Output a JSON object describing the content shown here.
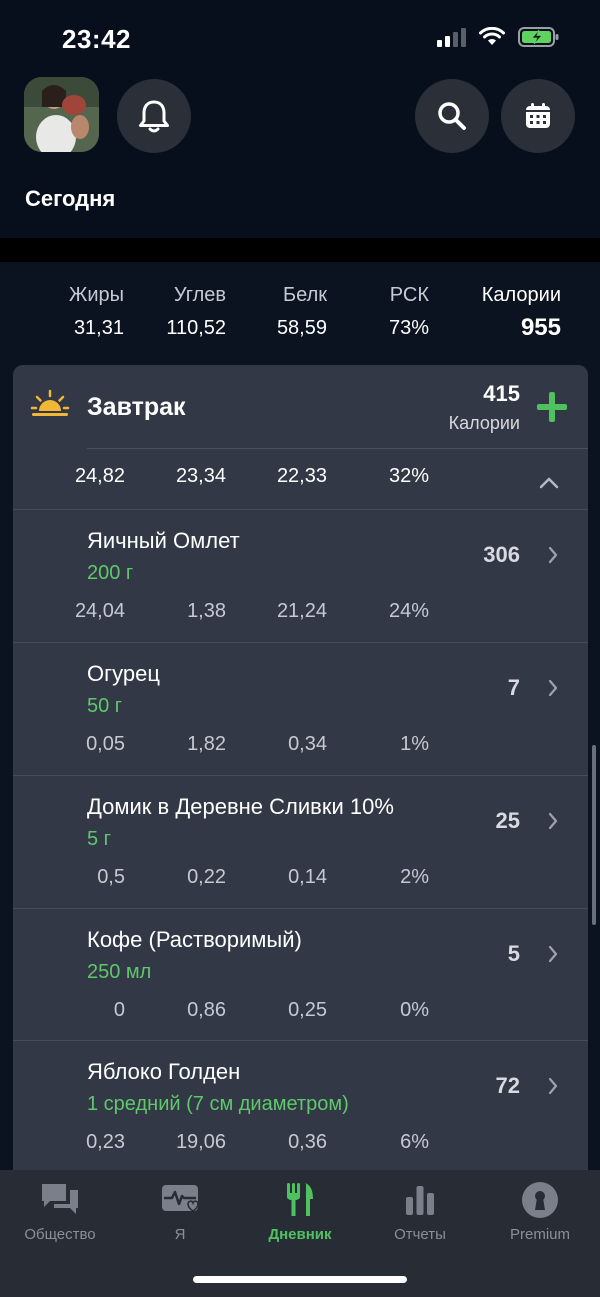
{
  "status_bar": {
    "time": "23:42"
  },
  "header": {
    "title": "Сегодня"
  },
  "totals": {
    "columns": [
      {
        "label": "Жиры",
        "value": "31,31"
      },
      {
        "label": "Углев",
        "value": "110,52"
      },
      {
        "label": "Белк",
        "value": "58,59"
      },
      {
        "label": "РСК",
        "value": "73%"
      },
      {
        "label": "Калории",
        "value": "955"
      }
    ]
  },
  "meal": {
    "title": "Завтрак",
    "calories": "415",
    "calories_label": "Калории",
    "macros": [
      "24,82",
      "23,34",
      "22,33",
      "32%"
    ],
    "items": [
      {
        "name": "Яичный Омлет",
        "portion": "200 г",
        "kcal": "306",
        "macros": [
          "24,04",
          "1,38",
          "21,24",
          "24%"
        ]
      },
      {
        "name": "Огурец",
        "portion": "50 г",
        "kcal": "7",
        "macros": [
          "0,05",
          "1,82",
          "0,34",
          "1%"
        ]
      },
      {
        "name": "Домик в Деревне Сливки 10%",
        "portion": "5 г",
        "kcal": "25",
        "macros": [
          "0,5",
          "0,22",
          "0,14",
          "2%"
        ]
      },
      {
        "name": "Кофе (Растворимый)",
        "portion": "250 мл",
        "kcal": "5",
        "macros": [
          "0",
          "0,86",
          "0,25",
          "0%"
        ]
      },
      {
        "name": "Яблоко Голден",
        "portion": "1 средний (7 см диаметром)",
        "kcal": "72",
        "macros": [
          "0,23",
          "19,06",
          "0,36",
          "6%"
        ]
      }
    ]
  },
  "tabs": [
    {
      "label": "Общество",
      "icon": "chat-icon"
    },
    {
      "label": "Я",
      "icon": "heart-pulse-icon"
    },
    {
      "label": "Дневник",
      "icon": "fork-knife-icon",
      "active": true
    },
    {
      "label": "Отчеты",
      "icon": "bar-chart-icon"
    },
    {
      "label": "Premium",
      "icon": "keyhole-icon"
    }
  ],
  "colors": {
    "accent": "#4fc25f",
    "portion": "#5fc86b",
    "card": "#323845",
    "background": "#0b1321"
  }
}
